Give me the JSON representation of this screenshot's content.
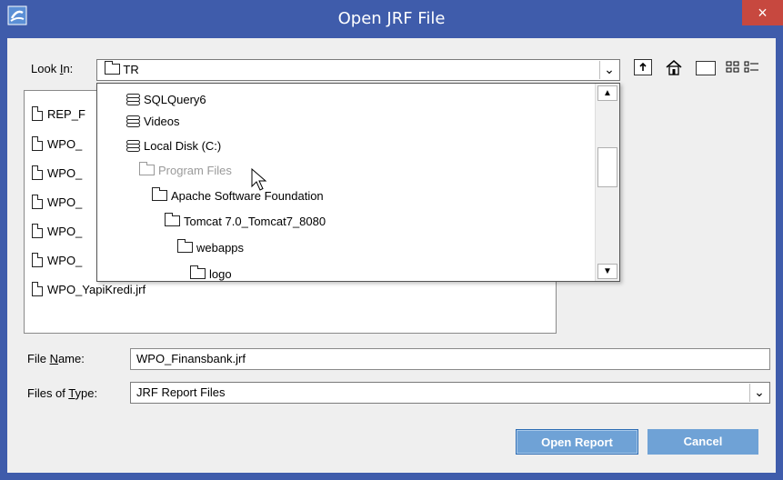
{
  "window": {
    "title": "Open JRF File",
    "close_glyph": "×",
    "app_icon": "jasper-app-icon"
  },
  "look_in": {
    "label_prefix": "Look ",
    "label_mnemonic": "I",
    "label_suffix": "n:",
    "value": "TR",
    "arrow": "⌄"
  },
  "toolbar": {
    "icons": [
      "up-folder-icon",
      "home-icon",
      "new-folder-icon",
      "list-view-icon",
      "details-view-icon"
    ]
  },
  "file_list": {
    "items": [
      "REP_F",
      "WPO_",
      "WPO_",
      "WPO_",
      "WPO_",
      "WPO_",
      "WPO_YapiKredi.jrf"
    ]
  },
  "look_in_dropdown": {
    "items": [
      {
        "label": "SQLQuery6",
        "icon": "drive-icon",
        "disabled": false
      },
      {
        "label": "Videos",
        "icon": "drive-icon",
        "disabled": false
      },
      {
        "label": "Local Disk (C:)",
        "icon": "drive-icon",
        "disabled": false
      },
      {
        "label": "Program Files",
        "icon": "folder-icon",
        "disabled": true
      },
      {
        "label": "Apache Software Foundation",
        "icon": "folder-icon",
        "disabled": false
      },
      {
        "label": "Tomcat 7.0_Tomcat7_8080",
        "icon": "folder-icon",
        "disabled": false
      },
      {
        "label": "webapps",
        "icon": "folder-icon",
        "disabled": false
      },
      {
        "label": "logo",
        "icon": "folder-icon",
        "disabled": false
      }
    ],
    "scroll_up": "▲",
    "scroll_down": "▼"
  },
  "file_name": {
    "label_prefix": "File ",
    "label_mnemonic": "N",
    "label_suffix": "ame:",
    "value": "WPO_Finansbank.jrf"
  },
  "file_type": {
    "label_prefix": "Files of ",
    "label_mnemonic": "T",
    "label_suffix": "ype:",
    "value": "JRF Report Files",
    "arrow": "⌄"
  },
  "buttons": {
    "open": "Open Report",
    "cancel": "Cancel"
  },
  "colors": {
    "titlebar": "#3f5cab",
    "close": "#c7483f",
    "button": "#6fa2d6"
  }
}
